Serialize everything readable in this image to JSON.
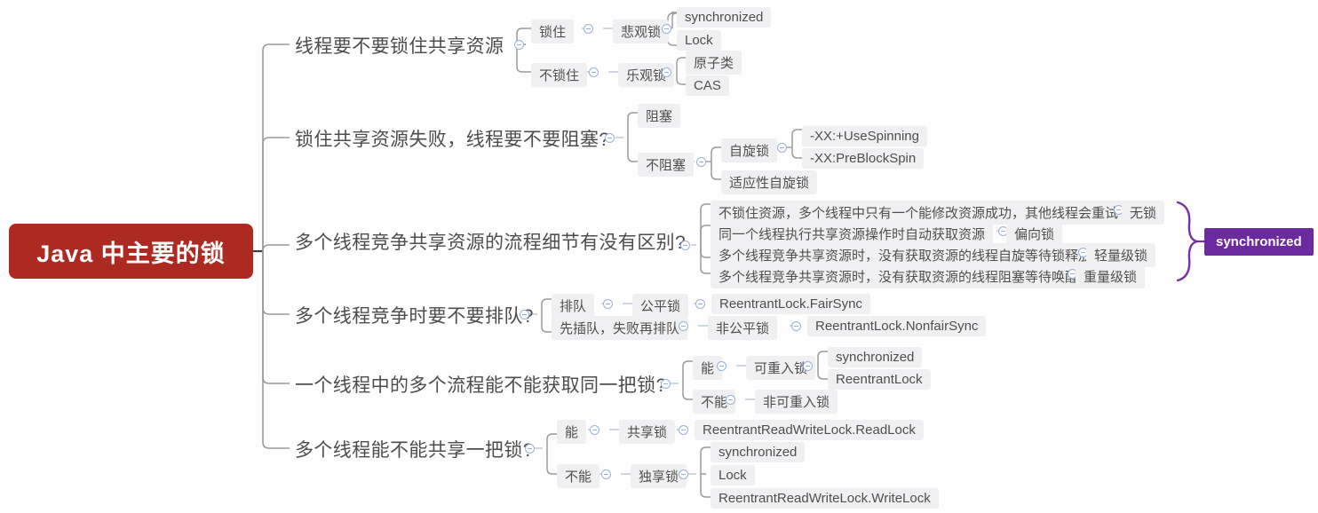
{
  "title": "Java 中主要的锁",
  "colors": {
    "root_bg": "#ad2a22",
    "node_bg": "#f0f0f2",
    "tag_bg": "#6b2a9e",
    "link": "#9a9a9a",
    "toggle": "#9bb0d4",
    "text": "#4f4f4f"
  },
  "root": {
    "label": "Java 中主要的锁"
  },
  "summary_tag": {
    "label": "synchronized"
  },
  "branches": [
    {
      "label": "线程要不要锁住共享资源",
      "children": [
        {
          "label": "锁住",
          "children": [
            {
              "label": "悲观锁",
              "children": [
                {
                  "label": "synchronized"
                },
                {
                  "label": "Lock"
                }
              ]
            }
          ]
        },
        {
          "label": "不锁住",
          "children": [
            {
              "label": "乐观锁",
              "children": [
                {
                  "label": "原子类"
                },
                {
                  "label": "CAS"
                }
              ]
            }
          ]
        }
      ]
    },
    {
      "label": "锁住共享资源失败，线程要不要阻塞?",
      "children": [
        {
          "label": "阻塞",
          "children": []
        },
        {
          "label": "不阻塞",
          "children": [
            {
              "label": "自旋锁",
              "children": [
                {
                  "label": "-XX:+UseSpinning"
                },
                {
                  "label": "-XX:PreBlockSpin"
                }
              ]
            },
            {
              "label": "适应性自旋锁"
            }
          ]
        }
      ]
    },
    {
      "label": "多个线程竞争共享资源的流程细节有没有区别?",
      "children": [
        {
          "label": "不锁住资源，多个线程中只有一个能修改资源成功，其他线程会重试",
          "children": [
            {
              "label": "无锁"
            }
          ]
        },
        {
          "label": "同一个线程执行共享资源操作时自动获取资源",
          "children": [
            {
              "label": "偏向锁"
            }
          ]
        },
        {
          "label": "多个线程竞争共享资源时，没有获取资源的线程自旋等待锁释放",
          "children": [
            {
              "label": "轻量级锁"
            }
          ]
        },
        {
          "label": "多个线程竞争共享资源时，没有获取资源的线程阻塞等待唤醒",
          "children": [
            {
              "label": "重量级锁"
            }
          ]
        }
      ]
    },
    {
      "label": "多个线程竞争时要不要排队?",
      "children": [
        {
          "label": "排队",
          "children": [
            {
              "label": "公平锁",
              "children": [
                {
                  "label": "ReentrantLock.FairSync"
                }
              ]
            }
          ]
        },
        {
          "label": "先插队，失败再排队",
          "children": [
            {
              "label": "非公平锁",
              "children": [
                {
                  "label": "ReentrantLock.NonfairSync"
                }
              ]
            }
          ]
        }
      ]
    },
    {
      "label": "一个线程中的多个流程能不能获取同一把锁?",
      "children": [
        {
          "label": "能",
          "children": [
            {
              "label": "可重入锁",
              "children": [
                {
                  "label": "synchronized"
                },
                {
                  "label": "ReentrantLock"
                }
              ]
            }
          ]
        },
        {
          "label": "不能",
          "children": [
            {
              "label": "非可重入锁"
            }
          ]
        }
      ]
    },
    {
      "label": "多个线程能不能共享一把锁?",
      "children": [
        {
          "label": "能",
          "children": [
            {
              "label": "共享锁",
              "children": [
                {
                  "label": "ReentrantReadWriteLock.ReadLock"
                }
              ]
            }
          ]
        },
        {
          "label": "不能",
          "children": [
            {
              "label": "独享锁",
              "children": [
                {
                  "label": "synchronized"
                },
                {
                  "label": "Lock"
                },
                {
                  "label": "ReentrantReadWriteLock.WriteLock"
                }
              ]
            }
          ]
        }
      ]
    }
  ]
}
